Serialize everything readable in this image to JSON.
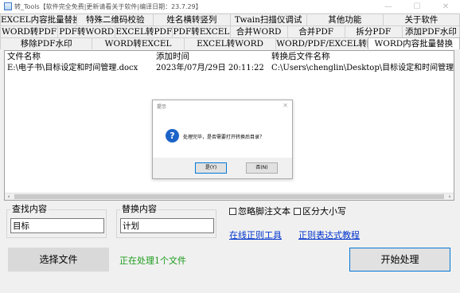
{
  "window": {
    "title": "转_Tools【软件完全免费|更新请看关于软件|编译日期：23.7.29】",
    "minimize_glyph": "—",
    "maximize_glyph": "☐",
    "close_glyph": "✕"
  },
  "tabs": {
    "row1": [
      "EXCEL内容批量替换",
      "特殊二维码校验",
      "姓名横转竖列",
      "Twain扫描仪调试",
      "其他功能",
      "关于软件"
    ],
    "row2": [
      "WORD转PDF",
      "PDF转WORD",
      "EXCEL转PDF",
      "PDF转EXCEL",
      "合并WORD",
      "合并PDF",
      "拆分PDF",
      "添加PDF水印"
    ],
    "row3": [
      "移除PDF水印",
      "WORD转EXCEL",
      "EXCEL转WORD",
      "WORD/PDF/EXCEL转图片",
      "WORD内容批量替换"
    ],
    "active": "WORD内容批量替换"
  },
  "file_list": {
    "columns": [
      "文件名称",
      "添加时间",
      "转换后文件名称"
    ],
    "rows": [
      [
        "E:\\电子书\\目标设定和时间管理.docx",
        "2023年/07月/29日 20:11:22",
        "C:\\Users\\chenglin\\Desktop\\目标设定和时间管理.docx"
      ]
    ],
    "scroll_left": "‹",
    "scroll_right": "›"
  },
  "dialog": {
    "title": "提示",
    "close": "✕",
    "icon": "question-icon",
    "icon_glyph": "?",
    "message": "处理完毕，是否需要打开转换后目录？",
    "yes": "是(Y)",
    "no": "否(N)"
  },
  "find": {
    "label": "查找内容",
    "value": "目标"
  },
  "replace": {
    "label": "替换内容",
    "value": "计划"
  },
  "options": {
    "ignore_footnotes": {
      "label": "忽略脚注文本",
      "checked": false
    },
    "case_sensitive": {
      "label": "区分大小写",
      "checked": false
    }
  },
  "links": {
    "online_regex": "在线正则工具",
    "regex_tutorial": "正则表达式教程"
  },
  "buttons": {
    "select_files": "选择文件",
    "start": "开始处理"
  },
  "status": "正在处理1个文件",
  "colors": {
    "accent": "#0078d7",
    "status_green": "#1a9b1a",
    "link": "#0033cc"
  }
}
